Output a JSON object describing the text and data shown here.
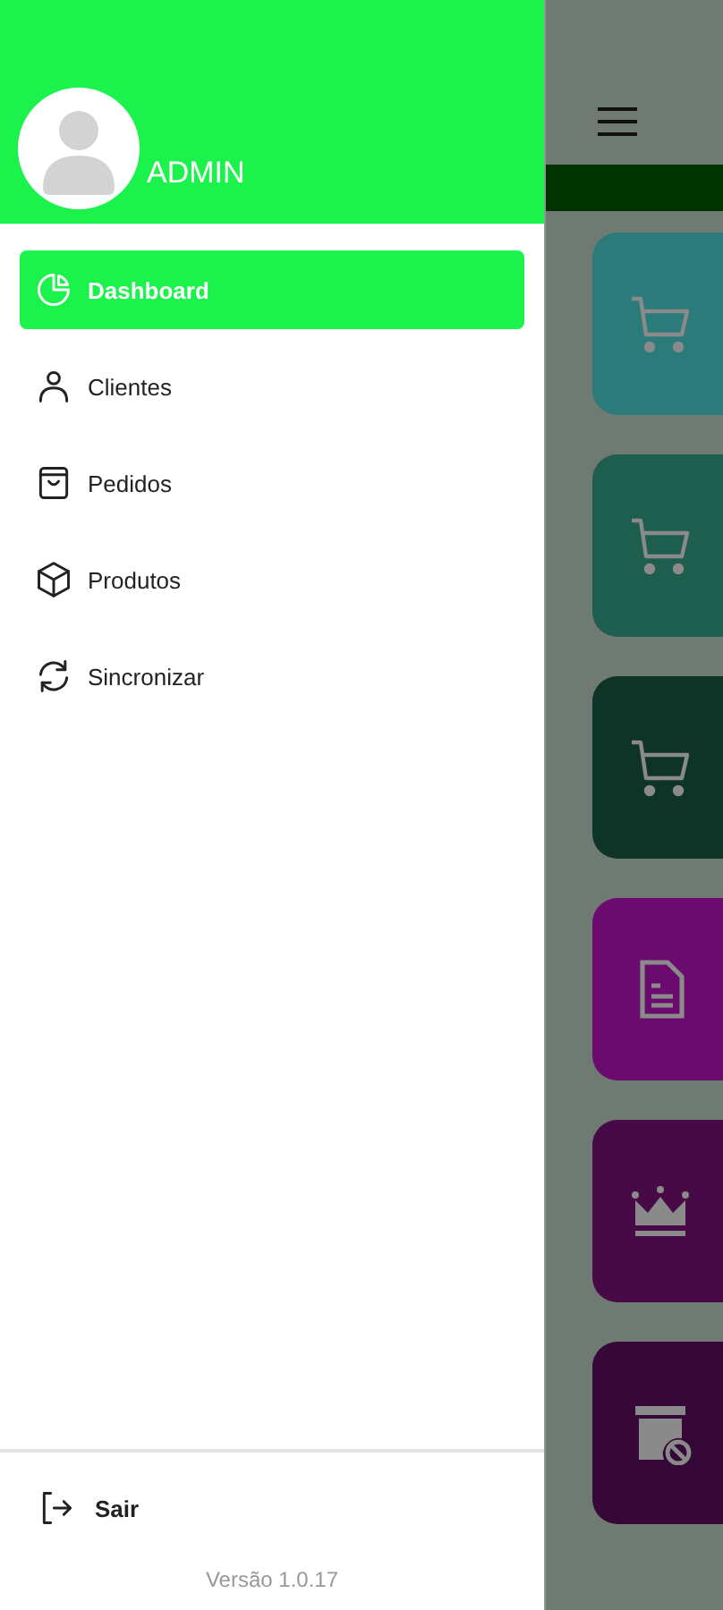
{
  "drawer": {
    "user": {
      "name": "ADMIN"
    },
    "menu": [
      {
        "label": "Dashboard",
        "kind": "dashboard",
        "selected": true
      },
      {
        "label": "Clientes",
        "kind": "user",
        "selected": false
      },
      {
        "label": "Pedidos",
        "kind": "bag",
        "selected": false
      },
      {
        "label": "Produtos",
        "kind": "box",
        "selected": false
      },
      {
        "label": "Sincronizar",
        "kind": "sync",
        "selected": false
      }
    ],
    "logout": {
      "label": "Sair"
    },
    "version": "Versão 1.0.17"
  },
  "background": {
    "cards": [
      {
        "kind": "cart",
        "color": "#2a7b79"
      },
      {
        "kind": "cart",
        "color": "#1e5e4f"
      },
      {
        "kind": "cart",
        "color": "#0e3327"
      },
      {
        "kind": "document",
        "color": "#6b0a6f"
      },
      {
        "kind": "crown",
        "color": "#470a47"
      },
      {
        "kind": "archive",
        "color": "#360837"
      }
    ]
  }
}
